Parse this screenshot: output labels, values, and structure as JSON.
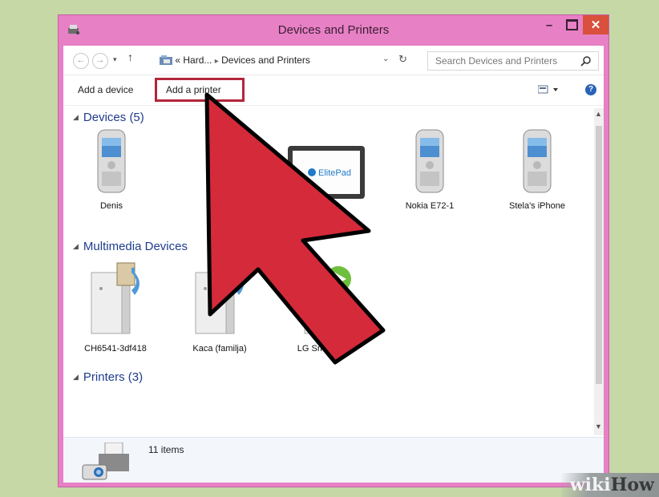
{
  "window": {
    "title": "Devices and Printers"
  },
  "nav": {
    "back_icon": "back-arrow-icon",
    "forward_icon": "forward-arrow-icon",
    "up_icon": "up-arrow-icon",
    "breadcrumb_prefix": "«",
    "breadcrumb_parent": "Hard...",
    "breadcrumb_sep": "▸",
    "breadcrumb_current": "Devices and Printers",
    "search_placeholder": "Search Devices and Printers"
  },
  "toolbar": {
    "add_device": "Add a device",
    "add_printer": "Add a printer"
  },
  "groups": {
    "devices": {
      "title": "Devices (5)",
      "items": [
        {
          "label": "Denis",
          "icon": "phone-icon"
        },
        {
          "label": "",
          "icon": "tablet-icon"
        },
        {
          "label": "",
          "icon": "tablet-icon"
        },
        {
          "label": "Nokia E72-1",
          "icon": "phone-icon"
        },
        {
          "label": "Stela's iPhone",
          "icon": "phone-icon"
        }
      ],
      "tablet_brand": "ElitePad"
    },
    "multimedia": {
      "title": "Multimedia Devices",
      "items": [
        {
          "label": "CH6541-3df418",
          "icon": "media-server-icon"
        },
        {
          "label": "Kaca (familja)",
          "icon": "media-server-icon"
        },
        {
          "label": "LG Smart+ TV",
          "icon": "media-player-icon"
        }
      ]
    },
    "printers": {
      "title": "Printers (3)"
    }
  },
  "status": {
    "item_count": "11 items"
  },
  "watermark": {
    "wiki": "wiki",
    "how": "How"
  },
  "colors": {
    "titlebar": "#e780c5",
    "close": "#d9503c",
    "highlight": "#b3263a",
    "arrow": "#d42a3a"
  }
}
